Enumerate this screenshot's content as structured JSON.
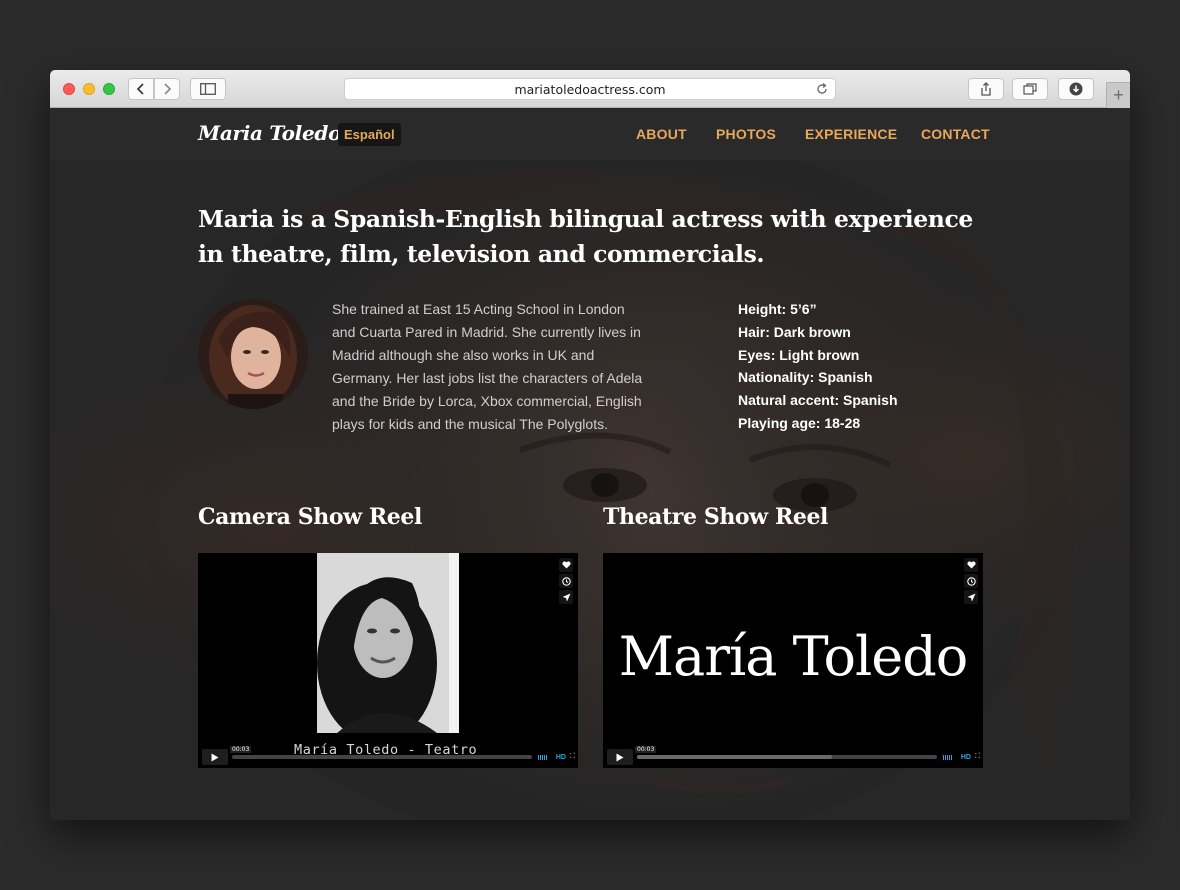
{
  "browser": {
    "url": "mariatoledoactress.com"
  },
  "site": {
    "brand": "Maria Toledo",
    "language_switch": "Español",
    "nav": [
      "ABOUT",
      "PHOTOS",
      "EXPERIENCE",
      "CONTACT"
    ]
  },
  "about": {
    "headline": "Maria is a Spanish-English bilingual actress with experience in theatre, film, television and commercials.",
    "bio": "She trained at East 15 Acting School in London and Cuarta Pared in Madrid. She currently lives in Madrid although she also works in UK and Germany. Her last jobs list the characters of Adela and the Bride by Lorca, Xbox commercial, English plays for kids and the musical The Polyglots.",
    "stats": [
      "Height: 5’6”",
      "Hair: Dark brown",
      "Eyes: Light brown",
      "Nationality: Spanish",
      "Natural accent: Spanish",
      "Playing age: 18-28"
    ]
  },
  "reels": {
    "camera": {
      "title": "Camera Show Reel",
      "caption": "María Toledo - Teatro",
      "time": "00:03",
      "hd_label": "HD"
    },
    "theatre": {
      "title": "Theatre Show Reel",
      "overlay_text": "María Toledo",
      "time": "00:03",
      "hd_label": "HD"
    }
  },
  "colors": {
    "accent": "#e8a85a",
    "nav_bg": "#2a2a2b",
    "player_accent": "#2da6e0"
  },
  "icons": [
    "back-icon",
    "forward-icon",
    "sidebar-icon",
    "reload-icon",
    "share-icon",
    "tabs-icon",
    "download-icon",
    "plus-icon",
    "heart-icon",
    "clock-icon",
    "send-icon",
    "play-icon",
    "fullscreen-icon"
  ]
}
